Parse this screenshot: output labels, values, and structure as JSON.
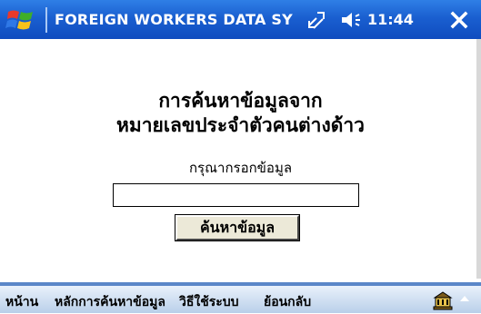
{
  "titlebar": {
    "title": "FOREIGN WORKERS DATA SYSTE!",
    "time": "11:44",
    "close_label": "✕"
  },
  "content": {
    "heading_line1": "การค้นหาข้อมูลจาก",
    "heading_line2": "หมายเลขประจำตัวคนต่างด้าว",
    "prompt": "กรุณากรอกข้อมูล",
    "search_value": "",
    "search_button": "ค้นหาข้อมูล"
  },
  "menu": {
    "items": [
      "หน้าน",
      "หลักการค้นหาข้อมูล",
      "วิธีใช้ระบบ",
      "ย้อนกลับ"
    ]
  },
  "icons": {
    "start": "windows-flag-icon",
    "network": "network-icon",
    "volume": "volume-icon",
    "close": "close-icon",
    "keyboard": "keyboard-icon",
    "up": "chevron-up-icon"
  },
  "colors": {
    "titlebar": "#1a5fd0",
    "menubar": "#b9cfe9",
    "button": "#ece9d8"
  }
}
